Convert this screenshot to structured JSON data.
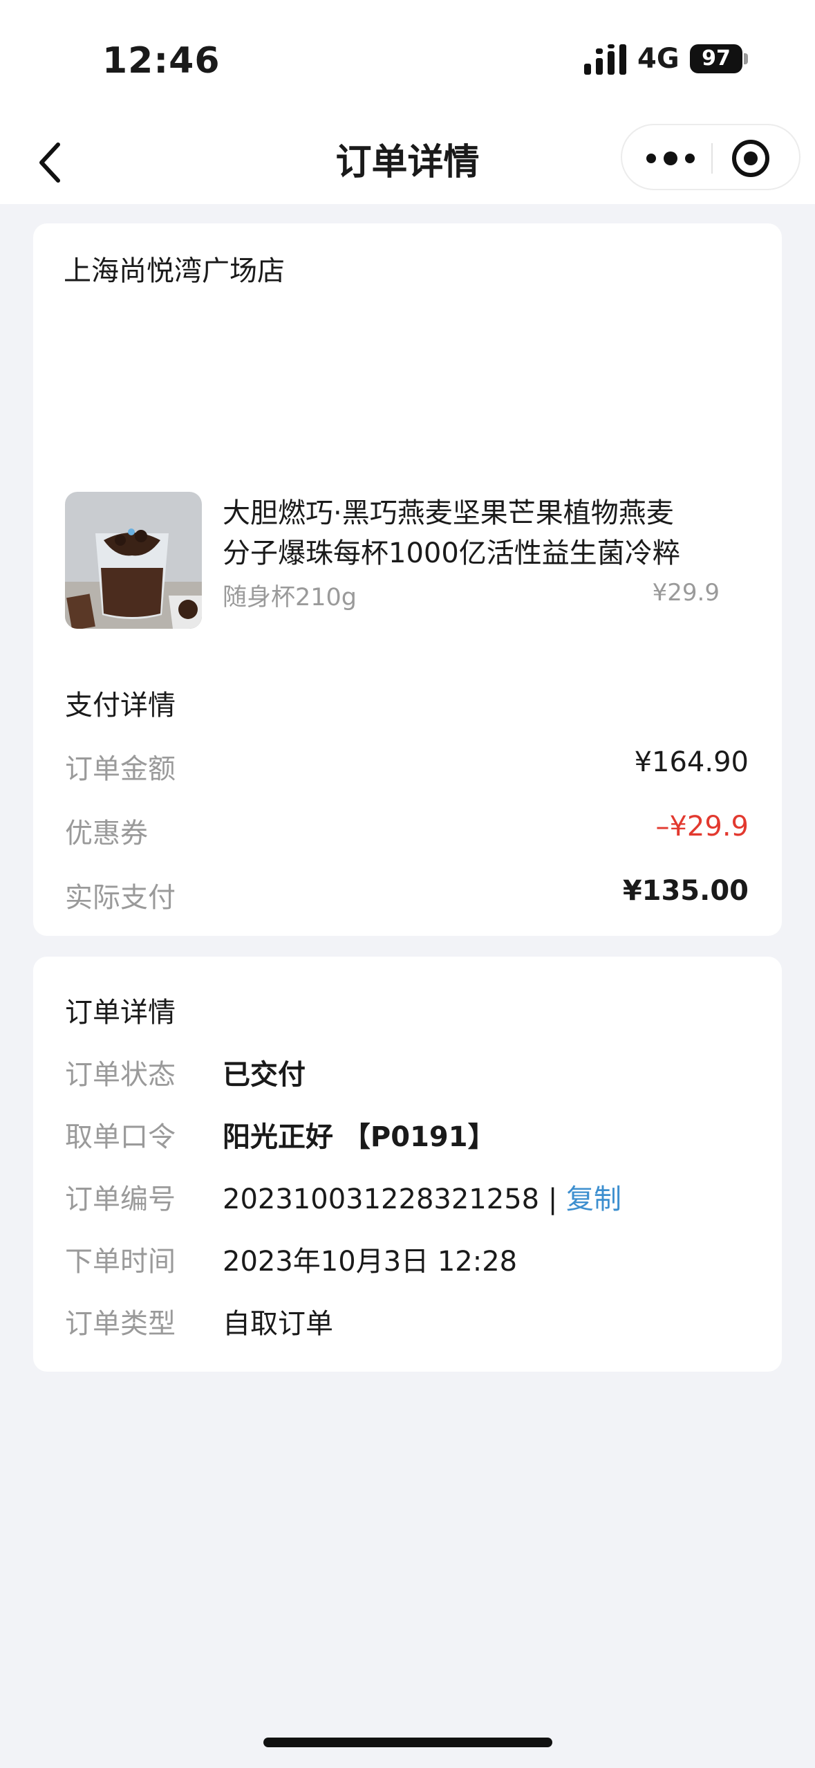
{
  "status_bar": {
    "time": "12:46",
    "network": "4G",
    "battery": "97"
  },
  "nav": {
    "title": "订单详情"
  },
  "store": {
    "name": "上海尚悦湾广场店"
  },
  "product": {
    "name_line1": "大胆燃巧·黑巧燕麦坚果芒果植物燕麦",
    "name_line2": "分子爆珠每杯1000亿活性益生菌冷粹",
    "spec": "随身杯210g",
    "price": "¥29.9"
  },
  "payment": {
    "title": "支付详情",
    "rows": [
      {
        "label": "订单金额",
        "value": "¥164.90"
      },
      {
        "label": "优惠券",
        "value": "–¥29.9"
      },
      {
        "label": "实际支付",
        "value": "¥135.00"
      }
    ]
  },
  "order": {
    "title": "订单详情",
    "status_label": "订单状态",
    "status_value": "已交付",
    "code_label": "取单口令",
    "code_value": "阳光正好 【P0191】",
    "number_label": "订单编号",
    "number_value": "202310031228321258",
    "separator": "|",
    "copy_label": "复制",
    "time_label": "下单时间",
    "time_value": "2023年10月3日 12:28",
    "type_label": "订单类型",
    "type_value": "自取订单"
  },
  "colors": {
    "discount": "#e2392f",
    "link": "#3d8fcf",
    "background": "#f2f3f7"
  }
}
